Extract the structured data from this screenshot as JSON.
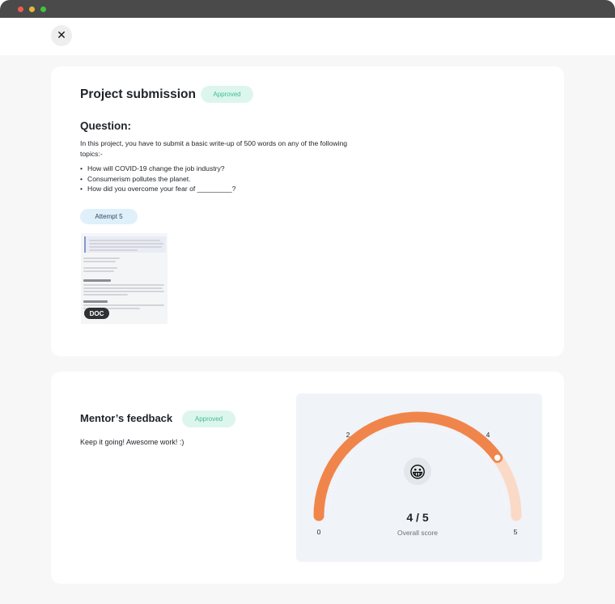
{
  "window": {
    "controls": [
      "close",
      "minimize",
      "maximize"
    ]
  },
  "topbar": {
    "close_icon": "close-icon",
    "close_glyph": "✕"
  },
  "submission": {
    "title": "Project submission",
    "status": "Approved",
    "question_heading": "Question:",
    "question_text": "In this project, you have to submit a basic write-up of 500 words on any of the following topics:-",
    "topics": [
      "How will COVID-19 change the job industry?",
      "Consumerism pollutes the planet.",
      "How did you overcome your fear of _________?"
    ],
    "attempt_label": "Attempt 5",
    "attachment_type": "DOC"
  },
  "feedback": {
    "title": "Mentor’s feedback",
    "status": "Approved",
    "comment": "Keep it going! Awesome work! :)",
    "score": {
      "value": 4,
      "max": 5,
      "display": "4 / 5",
      "label": "Overall score",
      "tick_labels": [
        "0",
        "2",
        "4",
        "5"
      ],
      "emoji": "😀"
    }
  },
  "colors": {
    "accent_orange": "#f0854b",
    "track_peach": "#fbd9c7",
    "approved_bg": "#dcf6ee",
    "approved_text": "#3fbd90",
    "attempt_bg": "#dff0fb"
  }
}
